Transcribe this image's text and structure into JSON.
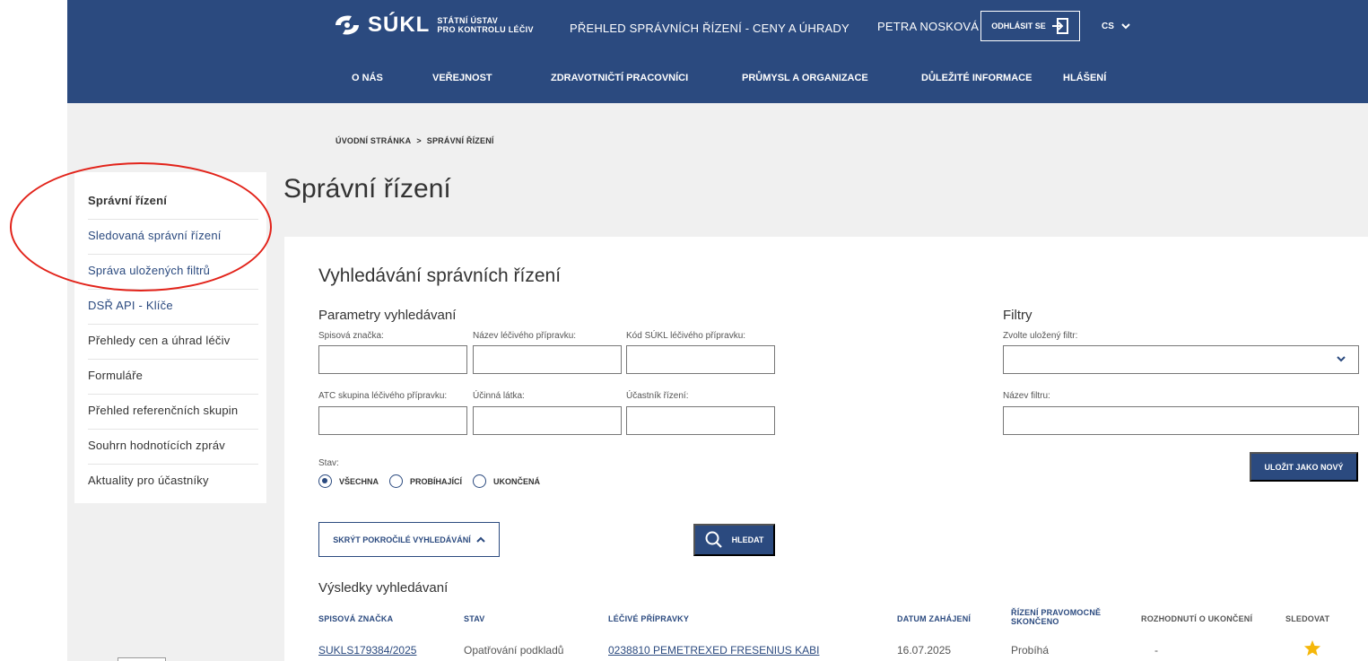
{
  "header": {
    "logo_text": "SÚKL",
    "logo_sub_1": "STÁTNÍ ÚSTAV",
    "logo_sub_2": "PRO KONTROLU LÉČIV",
    "app_title": "PŘEHLED SPRÁVNÍCH ŘÍZENÍ - CENY A ÚHRADY",
    "user_name": "PETRA NOSKOVÁ",
    "logout_label": "ODHLÁSIT SE",
    "lang": "CS",
    "bg_color": "#2b4a7f"
  },
  "mainnav": [
    {
      "label": "O NÁS"
    },
    {
      "label": "VEŘEJNOST"
    },
    {
      "label": "ZDRAVOTNIČTÍ PRACOVNÍCI"
    },
    {
      "label": "PRŮMYSL A ORGANIZACE"
    },
    {
      "label": "DŮLEŽITÉ INFORMACE"
    },
    {
      "label": "HLÁŠENÍ"
    }
  ],
  "breadcrumb": {
    "home": "ÚVODNÍ STRÁNKA",
    "separator": ">",
    "current": "SPRÁVNÍ ŘÍZENÍ"
  },
  "sidebar": {
    "items": [
      {
        "label": "Správní řízení"
      },
      {
        "label": "Sledovaná správní řízení"
      },
      {
        "label": "Správa uložených filtrů"
      },
      {
        "label": "DSŘ API - Klíče"
      },
      {
        "label": "Přehledy cen a úhrad léčiv"
      },
      {
        "label": "Formuláře"
      },
      {
        "label": "Přehled referenčních skupin"
      },
      {
        "label": "Souhrn hodnotících zpráv"
      },
      {
        "label": "Aktuality pro účastníky"
      }
    ]
  },
  "page_title": "Správní řízení",
  "search": {
    "heading": "Vyhledávání správních řízení",
    "params_heading": "Parametry vyhledávaní",
    "fields": {
      "spisova_znacka": {
        "label": "Spisová značka:",
        "value": ""
      },
      "nazev_pripravku": {
        "label": "Název léčivého přípravku:",
        "value": ""
      },
      "kod_sukl": {
        "label": "Kód SÚKL léčivého přípravku:",
        "value": ""
      },
      "atc": {
        "label": "ATC skupina léčivého přípravku:",
        "value": ""
      },
      "ucinna_latka": {
        "label": "Účinná látka:",
        "value": ""
      },
      "ucastnik": {
        "label": "Účastník řízení:",
        "value": ""
      }
    },
    "state_label": "Stav:",
    "state_options": [
      {
        "label": "VŠECHNA",
        "selected": true
      },
      {
        "label": "PROBÍHAJÍCÍ",
        "selected": false
      },
      {
        "label": "UKONČENÁ",
        "selected": false
      }
    ],
    "toggle_advanced_label": "SKRÝT POKROČILÉ VYHLEDÁVÁNÍ",
    "search_button_label": "HLEDAT"
  },
  "filters": {
    "heading": "Filtry",
    "saved_filter_label": "Zvolte uložený filtr:",
    "saved_filter_value": "",
    "filter_name_label": "Název filtru:",
    "filter_name_value": "",
    "save_button_label": "ULOŽIT JAKO NOVÝ"
  },
  "results": {
    "heading": "Výsledky vyhledávaní",
    "columns": [
      "SPISOVÁ ZNAČKA",
      "STAV",
      "LÉČIVÉ PŘÍPRAVKY",
      "DATUM ZAHÁJENÍ",
      "ŘÍZENÍ PRAVOMOCNĚ",
      "SKONČENO",
      "ROZHODNUTÍ O UKONČENÍ",
      "SLEDOVAT"
    ],
    "rows": [
      {
        "spisova_znacka": "SUKLS179384/2025",
        "stav": "Opatřování podkladů",
        "pripravky": "0238810 PEMETREXED FRESENIUS KABI",
        "datum_zahajeni": "16.07.2025",
        "pravomocne": "Probíhá",
        "rozhodnuti": "-",
        "sledovat": "star-filled"
      }
    ]
  },
  "colors": {
    "primary": "#2b4a7f",
    "annotation": "#e2231a",
    "star": "#f5b70a"
  }
}
